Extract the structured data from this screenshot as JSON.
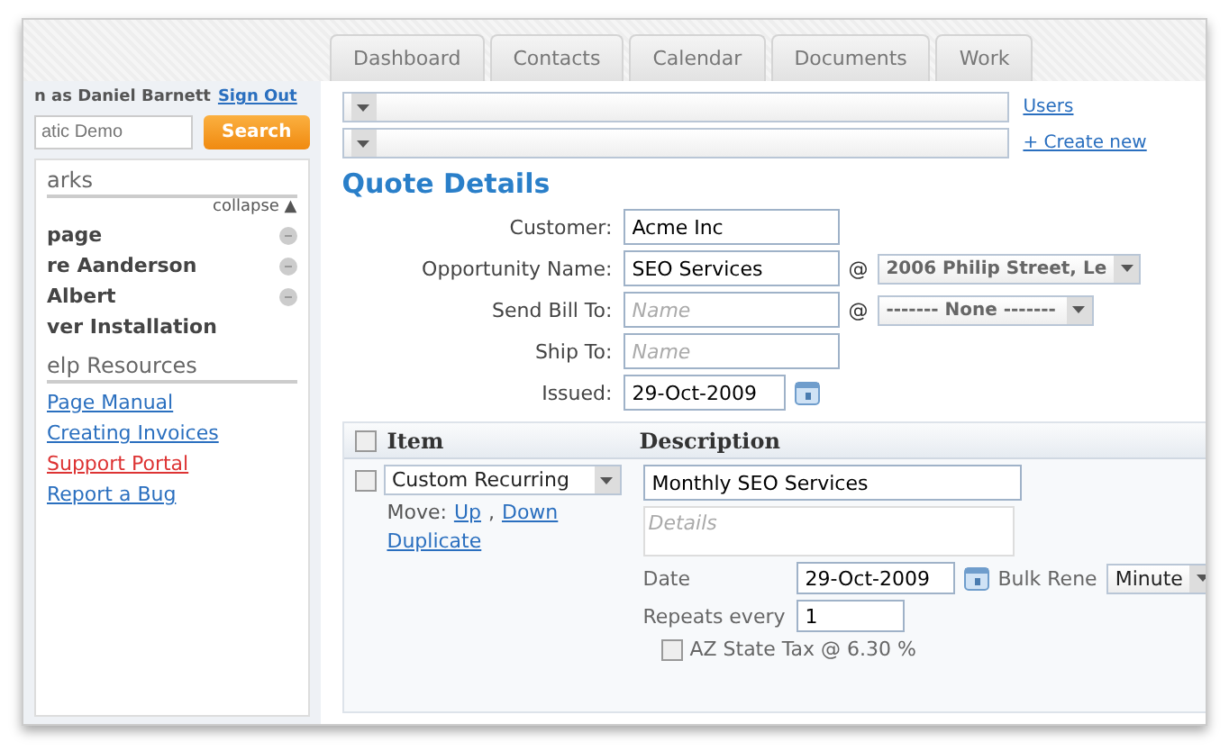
{
  "tabs": [
    {
      "label": "Dashboard",
      "selected": false
    },
    {
      "label": "Contacts",
      "selected": false
    },
    {
      "label": "Calendar",
      "selected": false
    },
    {
      "label": "Documents",
      "selected": false
    },
    {
      "label": "Work",
      "selected": false
    }
  ],
  "account": {
    "prefix": "n as Daniel Barnett",
    "link": "Sign Out"
  },
  "search": {
    "placeholder": "atic Demo",
    "button": "Search"
  },
  "bookmarks": {
    "title": "arks",
    "toggle": "collapse ▲",
    "items": [
      {
        "label": "page",
        "removable": true
      },
      {
        "label": "re Aanderson",
        "removable": true
      },
      {
        "label": "Albert",
        "removable": true
      },
      {
        "label": "ver Installation",
        "removable": false
      }
    ]
  },
  "help": {
    "title": "elp Resources",
    "links": [
      {
        "label": "Page Manual",
        "kind": "normal"
      },
      {
        "label": "Creating Invoices",
        "kind": "normal"
      },
      {
        "label": "Support Portal",
        "kind": "alert"
      },
      {
        "label": "Report a Bug",
        "kind": "normal"
      }
    ]
  },
  "top_links": [
    "Users",
    "+ Create new"
  ],
  "quote": {
    "title": "Quote Details",
    "fields": [
      {
        "label": "Customer:",
        "kind": "text",
        "value": "Acme Inc"
      },
      {
        "label": "Opportunity Name:",
        "kind": "text",
        "value": "SEO Services",
        "at": "@",
        "select": "2006 Philip Street, Le"
      },
      {
        "label": "Send Bill To:",
        "kind": "text",
        "placeholder": "Name",
        "at": "@",
        "select": "------- None -------"
      },
      {
        "label": "Ship To:",
        "kind": "text",
        "placeholder": "Name"
      },
      {
        "label": "Issued:",
        "kind": "date",
        "value": "29-Oct-2009"
      }
    ]
  },
  "items_table": {
    "columns": [
      "Item",
      "Description"
    ],
    "header_checked": false,
    "rows": [
      {
        "checked": false,
        "item": "Custom Recurring",
        "move_label": "Move:",
        "up": "Up",
        "separator": ",",
        "down": "Down",
        "duplicate": "Duplicate",
        "description": "Monthly SEO Services",
        "details_placeholder": "Details",
        "date_label": "Date",
        "date": "29-Oct-2009",
        "bulk_label": "Bulk Rene",
        "unit": "Minute",
        "repeats_label": "Repeats every",
        "repeats": "1",
        "tax_checked": false,
        "tax_label": "AZ State Tax @ 6.30 %"
      }
    ]
  }
}
